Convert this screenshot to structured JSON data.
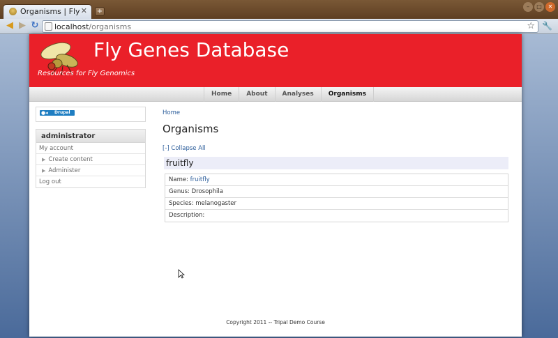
{
  "browser": {
    "tab_title": "Organisms | Fly Gene...",
    "new_tab": "+",
    "url_host": "localhost",
    "url_path": "/organisms"
  },
  "site": {
    "name": "Fly Genes Database",
    "slogan": "Resources for Fly Genomics"
  },
  "nav": {
    "items": [
      {
        "label": "Home"
      },
      {
        "label": "About"
      },
      {
        "label": "Analyses"
      },
      {
        "label": "Organisms"
      }
    ],
    "active": "Organisms"
  },
  "sidebar": {
    "drupal_badge": "Drupal",
    "user_block_title": "administrator",
    "menu": [
      {
        "label": "My account"
      },
      {
        "label": "Create content"
      },
      {
        "label": "Administer"
      },
      {
        "label": "Log out"
      }
    ]
  },
  "main": {
    "breadcrumb": "Home",
    "title": "Organisms",
    "collapse_all": "[-] Collapse All",
    "organism_heading": "fruitfly",
    "fields": {
      "name_label": "Name: ",
      "name_value": "fruitfly",
      "genus": "Genus: Drosophila",
      "species": "Species: melanogaster",
      "description": "Description:"
    }
  },
  "footer": {
    "text": "Copyright 2011 -- Tripal Demo Course"
  },
  "colors": {
    "header_red": "#ea2029",
    "link_blue": "#2a5c9a",
    "org_heading_bg": "#ecedf8"
  }
}
